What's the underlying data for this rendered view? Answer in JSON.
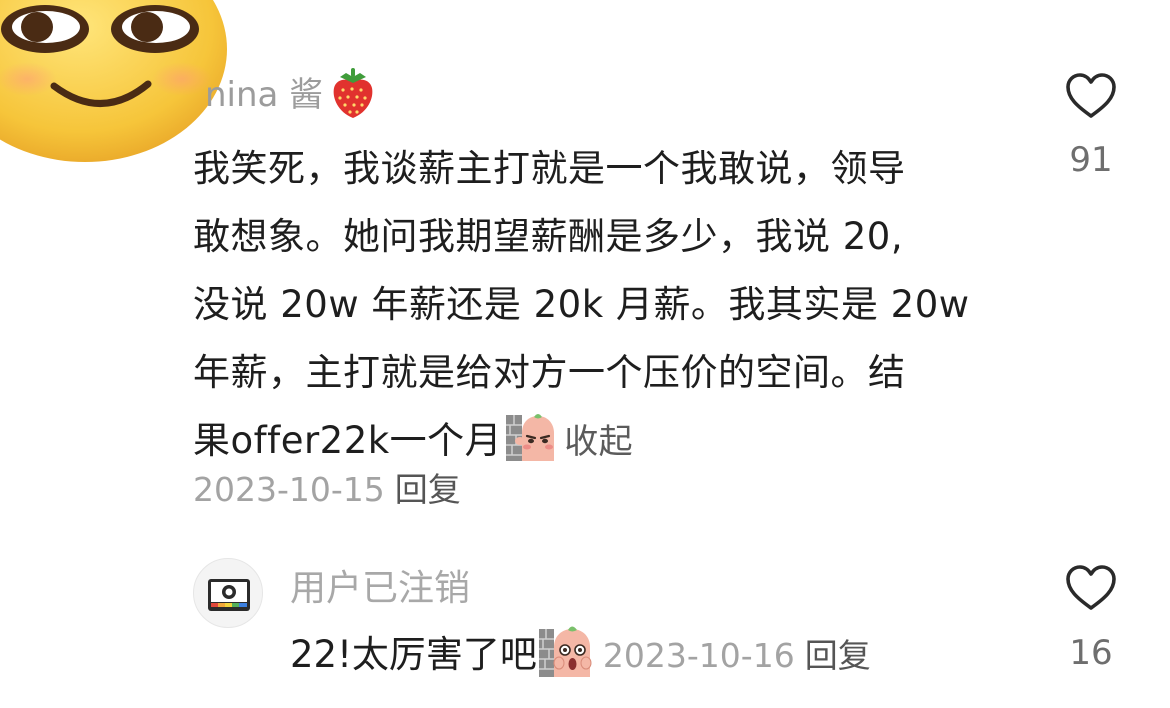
{
  "comment": {
    "username": "nina 酱",
    "lines": [
      "我笑死，我谈薪主打就是一个我敢说，领导",
      "敢想象。她问我期望薪酬是多少，我说 20,",
      "没说 20w 年薪还是 20k 月薪。我其实是 20w",
      "年薪，主打就是给对方一个压价的空间。结",
      "果offer22k一个月"
    ],
    "collapse_label": "收起",
    "date": "2023-10-15",
    "reply_label": "回复",
    "like_count": "91",
    "avatar_icon": "smiling-emoji-avatar",
    "username_badge_icon": "strawberry-icon"
  },
  "reply": {
    "username": "用户已注销",
    "text": "22!太厉害了吧",
    "date": "2023-10-16",
    "reply_label": "回复",
    "like_count": "16",
    "avatar_icon": "deleted-user-camera-icon"
  },
  "colors": {
    "text_primary": "#1e1e1e",
    "text_secondary": "#a3a3a3",
    "emoji_yellow": "#f7c948",
    "heart_outline": "#2a2a2a"
  }
}
